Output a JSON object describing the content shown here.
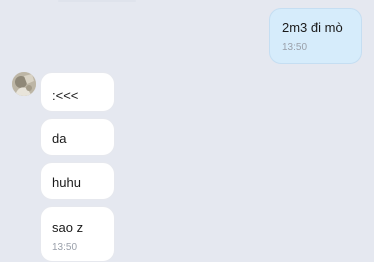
{
  "conversation": {
    "outgoing": [
      {
        "text": "2m3 đi mò",
        "time": "13:50"
      }
    ],
    "incoming": [
      {
        "text": ":<<<"
      },
      {
        "text": "da"
      },
      {
        "text": "huhu"
      },
      {
        "text": "sao z",
        "time": "13:50"
      }
    ]
  },
  "colors": {
    "background": "#e5e8f0",
    "outgoing_bubble": "#d6ecfb",
    "incoming_bubble": "#ffffff",
    "timestamp": "#9aa0aa"
  },
  "icons": {
    "avatar": "contact-avatar-photo"
  }
}
